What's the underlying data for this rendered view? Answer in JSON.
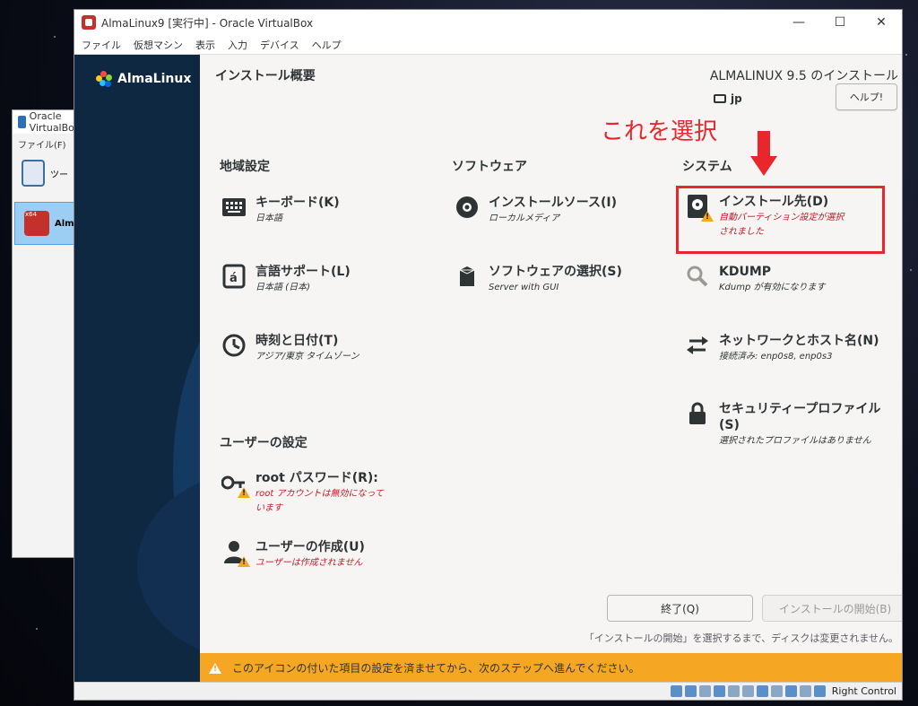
{
  "bg_window": {
    "title": "Oracle VirtualBox",
    "menu": "ファイル(F)",
    "tools_label": "ツー",
    "vm_label": "Alm",
    "vm_badge": "x64"
  },
  "window": {
    "title": "AlmaLinux9 [実行中] - Oracle VirtualBox",
    "controls": [
      "—",
      "☐",
      "✕"
    ],
    "menu": [
      "ファイル",
      "仮想マシン",
      "表示",
      "入力",
      "デバイス",
      "ヘルプ"
    ]
  },
  "installer": {
    "logo_text": "AlmaLinux",
    "page_title": "インストール概要",
    "product_title": "ALMALINUX 9.5 のインストール",
    "keyboard_layout": "jp",
    "help_button": "ヘルプ!",
    "annotation": "これを選択",
    "sections": {
      "localization": "地域設定",
      "software": "ソフトウェア",
      "system": "システム",
      "user": "ユーザーの設定"
    },
    "spokes": {
      "keyboard": {
        "title": "キーボード(K)",
        "status": "日本語"
      },
      "language": {
        "title": "言語サポート(L)",
        "status": "日本語 (日本)"
      },
      "datetime": {
        "title": "時刻と日付(T)",
        "status": "アジア/東京 タイムゾーン"
      },
      "source": {
        "title": "インストールソース(I)",
        "status": "ローカルメディア"
      },
      "software": {
        "title": "ソフトウェアの選択(S)",
        "status": "Server with GUI"
      },
      "destination": {
        "title": "インストール先(D)",
        "status_1": "自動パーティション設定が選択",
        "status_2": "されました"
      },
      "kdump": {
        "title": "KDUMP",
        "status": "Kdump が有効になります"
      },
      "network": {
        "title": "ネットワークとホスト名(N)",
        "status": "接続済み: enp0s8, enp0s3"
      },
      "security": {
        "title_1": "セキュリティープロファイル",
        "title_2": "(S)",
        "status": "選択されたプロファイルはありません"
      },
      "root": {
        "title": "root パスワード(R):",
        "status_1": "root アカウントは無効になって",
        "status_2": "います"
      },
      "user": {
        "title": "ユーザーの作成(U)",
        "status": "ユーザーは作成されません"
      }
    },
    "quit_button": "終了(Q)",
    "begin_button": "インストールの開始(B)",
    "notice": "「インストールの開始」を選択するまで、ディスクは変更されません。",
    "warning_bar": "このアイコンの付いた項目の設定を済ませてから、次のステップへ進んでください。"
  },
  "statusbar": {
    "hostkey": "Right Control"
  },
  "colors": {
    "sidebar": "#0e2841",
    "warning": "#f5a623",
    "annotation_red": "#e8262b",
    "error_text": "#c01c28"
  },
  "icons": {
    "keyboard": "keyboard-icon",
    "language": "language-icon",
    "clock": "clock-icon",
    "disc": "disc-icon",
    "package": "package-icon",
    "harddisk": "harddisk-icon",
    "search": "search-icon",
    "network": "network-arrows-icon",
    "lock": "lock-icon",
    "key": "key-icon",
    "user": "user-icon",
    "warning": "warning-icon"
  }
}
